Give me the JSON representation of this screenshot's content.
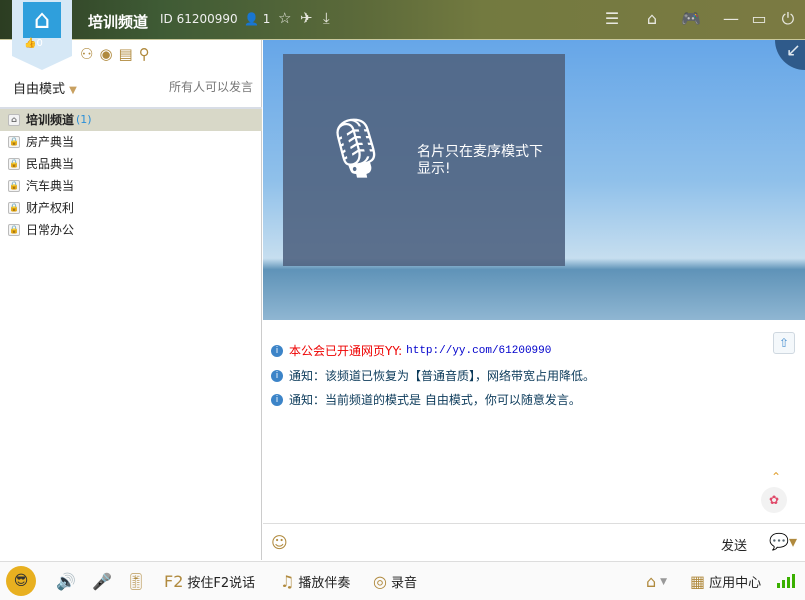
{
  "header": {
    "title": "培训频道",
    "channel_id": "ID 61200990",
    "user_count": "1",
    "likes": "0"
  },
  "sidebar": {
    "mode": "自由模式",
    "permission": "所有人可以发言",
    "channels": [
      {
        "label": "培训频道",
        "count": "(1)",
        "icon": "home-icon"
      },
      {
        "label": "房产典当",
        "icon": "lock-group-icon"
      },
      {
        "label": "民品典当",
        "icon": "lock-group-icon"
      },
      {
        "label": "汽车典当",
        "icon": "lock-icon"
      },
      {
        "label": "财产权利",
        "icon": "lock-group-icon"
      },
      {
        "label": "日常办公",
        "icon": "lock-icon"
      }
    ]
  },
  "stage": {
    "card_text": "名片只在麦序模式下显示!"
  },
  "chat": {
    "messages": [
      {
        "prefix": "本公会已开通网页YY:",
        "link": "http://yy.com/61200990"
      },
      {
        "text": "通知：该频道已恢复为【普通音质】，网络带宽占用降低。"
      },
      {
        "text": "通知：当前频道的模式是 自由模式，你可以随意发言。"
      }
    ]
  },
  "input": {
    "send": "发送"
  },
  "bottom": {
    "ptt": "按住F2说话",
    "music": "播放伴奏",
    "record": "录音",
    "apps": "应用中心"
  }
}
